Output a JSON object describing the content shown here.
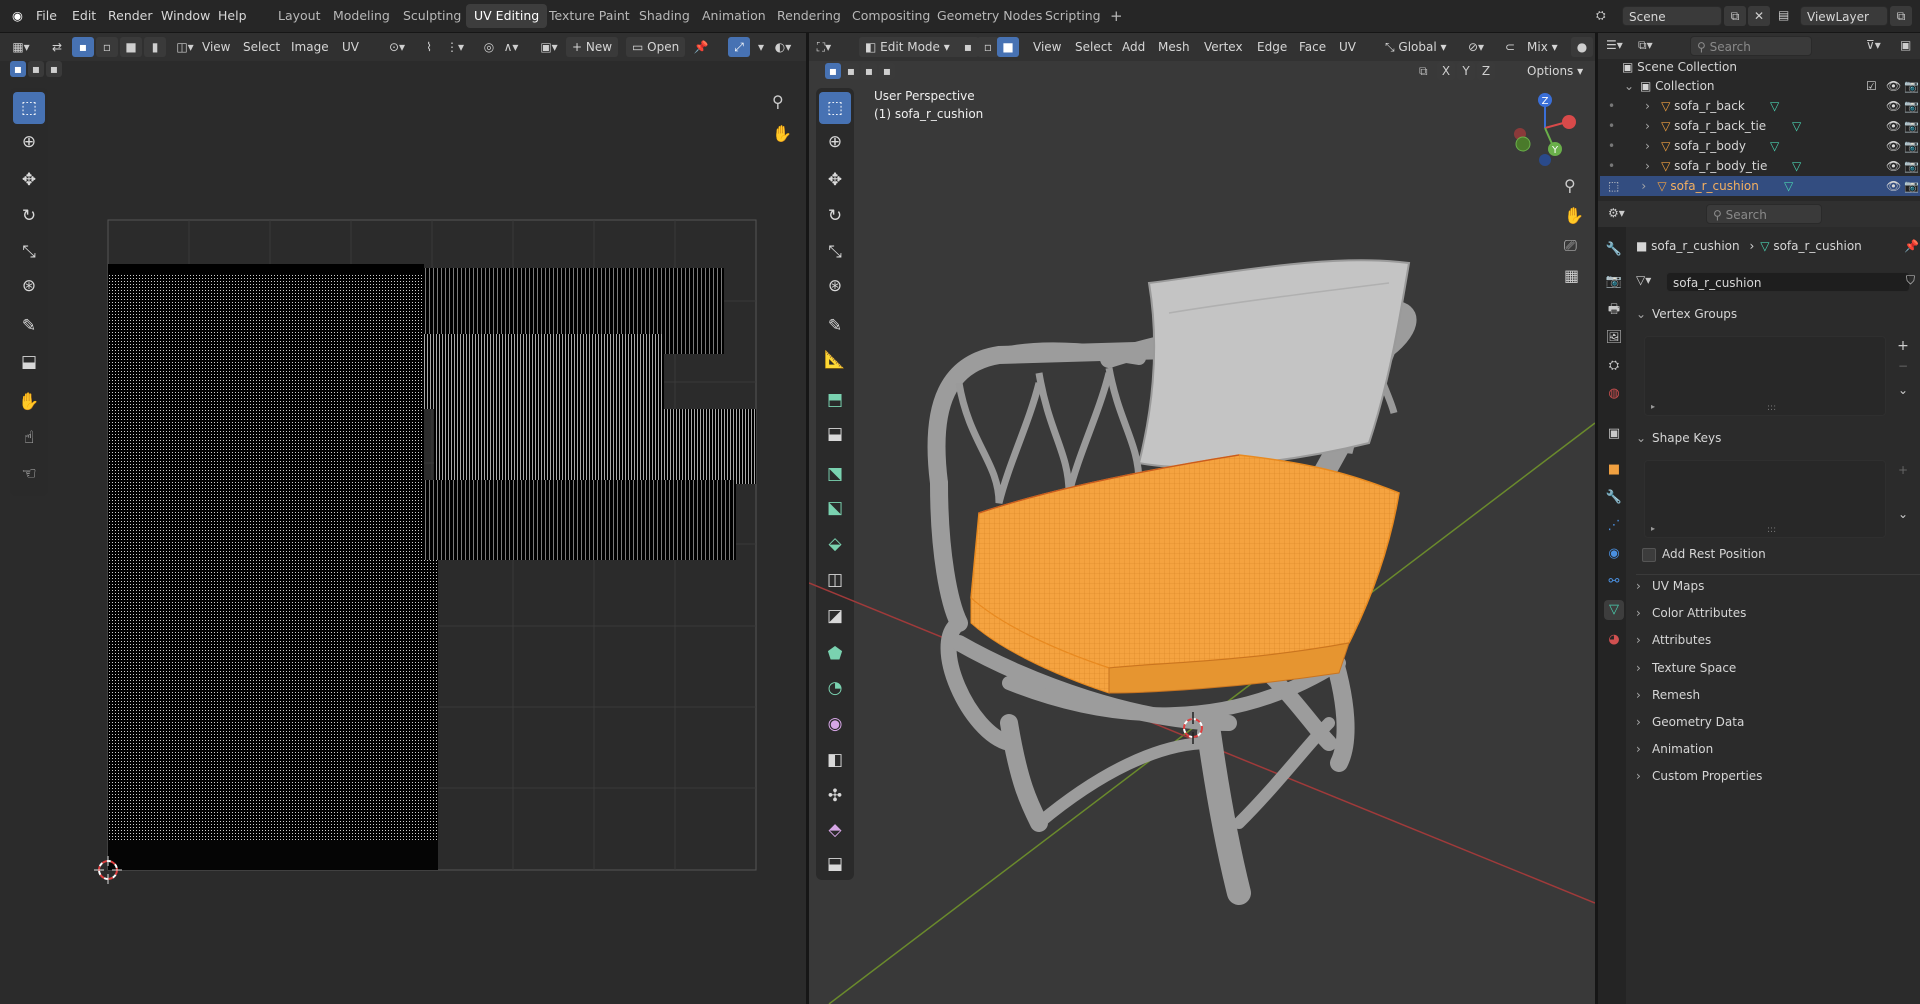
{
  "menubar": {
    "items": [
      "File",
      "Edit",
      "Render",
      "Window",
      "Help"
    ],
    "workspaces": [
      "Layout",
      "Modeling",
      "Sculpting",
      "UV Editing",
      "Texture Paint",
      "Shading",
      "Animation",
      "Rendering",
      "Compositing",
      "Geometry Nodes",
      "Scripting"
    ],
    "active_workspace": "UV Editing",
    "add_workspace": "+",
    "scene_label": "Scene",
    "viewlayer_label": "ViewLayer"
  },
  "uv_editor": {
    "menus": [
      "View",
      "Select",
      "Image",
      "UV"
    ],
    "new_label": "New",
    "open_label": "Open"
  },
  "viewport": {
    "mode": "Edit Mode",
    "menus": [
      "View",
      "Select",
      "Add",
      "Mesh",
      "Vertex",
      "Edge",
      "Face",
      "UV"
    ],
    "orientation": "Global",
    "shading_mix": "Mix",
    "overlay_line1": "User Perspective",
    "overlay_line2": "(1) sofa_r_cushion",
    "options_label": "Options",
    "axes": [
      "X",
      "Y",
      "Z"
    ],
    "gizmo_z": "Z",
    "gizmo_y": "Y",
    "selection_color": "#f5a340"
  },
  "outliner": {
    "search_placeholder": "Search",
    "scene_collection": "Scene Collection",
    "collection": "Collection",
    "objects": [
      "sofa_r_back",
      "sofa_r_back_tie",
      "sofa_r_body",
      "sofa_r_body_tie",
      "sofa_r_cushion"
    ],
    "selected_object": "sofa_r_cushion"
  },
  "properties": {
    "search_placeholder": "Search",
    "breadcrumb_object": "sofa_r_cushion",
    "breadcrumb_mesh": "sofa_r_cushion",
    "mesh_name": "sofa_r_cushion",
    "vertex_groups": "Vertex Groups",
    "shape_keys": "Shape Keys",
    "add_rest_position": "Add Rest Position",
    "sections": [
      "UV Maps",
      "Color Attributes",
      "Attributes",
      "Texture Space",
      "Remesh",
      "Geometry Data",
      "Animation",
      "Custom Properties"
    ]
  }
}
